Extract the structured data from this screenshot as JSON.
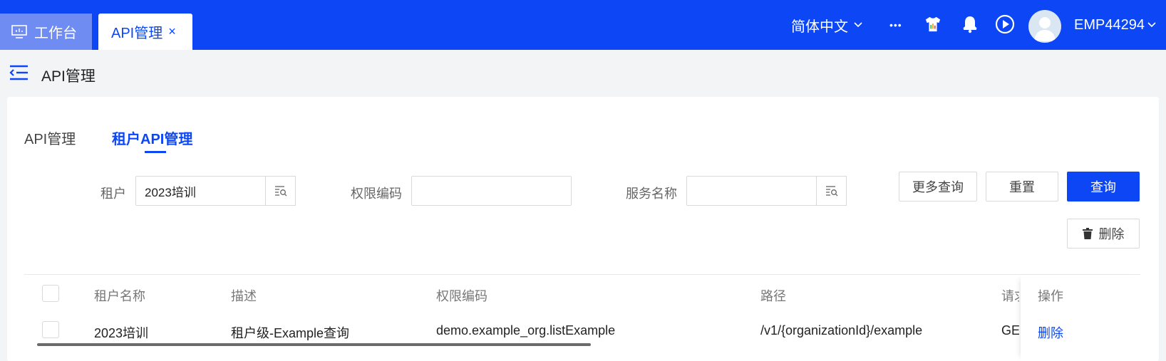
{
  "topbar": {
    "workbench_tab": "工作台",
    "active_tab": "API管理",
    "close_glyph": "×",
    "language": "简体中文",
    "more_glyph": "•••",
    "username": "EMP44294"
  },
  "page": {
    "title": "API管理"
  },
  "subtabs": [
    {
      "label": "API管理",
      "active": false
    },
    {
      "label": "租户API管理",
      "active": true
    }
  ],
  "filters": {
    "tenant_label": "租户",
    "tenant_value": "2023培训",
    "permission_code_label": "权限编码",
    "permission_code_value": "",
    "service_name_label": "服务名称",
    "service_name_value": ""
  },
  "buttons": {
    "more_query": "更多查询",
    "reset": "重置",
    "query": "查询",
    "delete": "删除"
  },
  "table": {
    "columns": [
      "租户名称",
      "描述",
      "权限编码",
      "路径",
      "请求方式",
      "操作"
    ],
    "rows": [
      {
        "tenant_name": "2023培训",
        "description": "租户级-Example查询",
        "permission_code": "demo.example_org.listExample",
        "path": "/v1/{organizationId}/example",
        "method": "GET",
        "action": "删除"
      }
    ]
  },
  "colors": {
    "primary": "#0d47f5",
    "topbar": "#0d47f5",
    "workbench_tab_bg": "#6f8cf2"
  }
}
